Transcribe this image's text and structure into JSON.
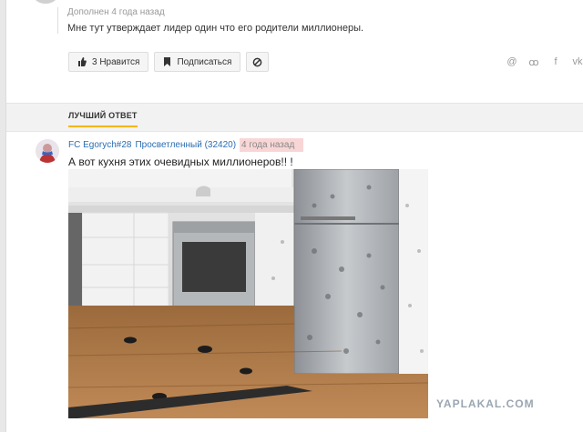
{
  "question": {
    "meta": "Дополнен 4 года назад",
    "text": "Мне тут утверждает лидер один что его родители миллионеры.",
    "like_label": "3 Нравится",
    "subscribe_label": "Подписаться"
  },
  "share_icons": [
    "@",
    "ok",
    "f",
    "vk"
  ],
  "best_answer": {
    "tab_label": "ЛУЧШИЙ ОТВЕТ",
    "author": "FC Egorych#28",
    "rank": "Просветленный (32420)",
    "time": "4 года назад",
    "text": "А вот кухня этих очевидных миллионеров!! !"
  },
  "watermark": "YAPLAKAL.COM",
  "colors": {
    "link": "#2a6db3",
    "accent": "#f4b700",
    "highlight": "#f9d6d6"
  }
}
